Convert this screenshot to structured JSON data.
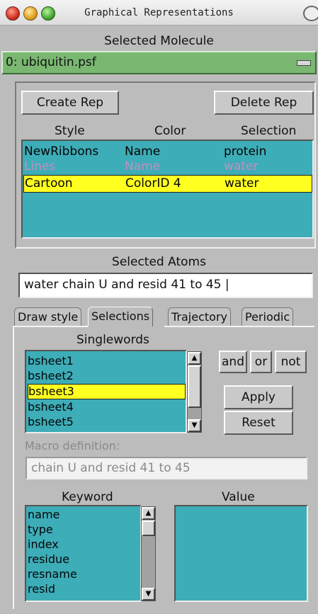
{
  "window": {
    "title": "Graphical Representations"
  },
  "molecule": {
    "section_label": "Selected Molecule",
    "value": "0: ubiquitin.psf"
  },
  "reps": {
    "create_label": "Create Rep",
    "delete_label": "Delete Rep",
    "headers": {
      "style": "Style",
      "color": "Color",
      "selection": "Selection"
    },
    "rows": [
      {
        "style": "NewRibbons",
        "color": "Name",
        "selection": "protein"
      },
      {
        "style": "Lines",
        "color": "Name",
        "selection": "water"
      },
      {
        "style": "Cartoon",
        "color": "ColorID 4",
        "selection": "water"
      }
    ]
  },
  "selected_atoms": {
    "label": "Selected Atoms",
    "value": "water chain U and resid 41 to 45 |"
  },
  "tabs": [
    {
      "label": "Draw style"
    },
    {
      "label": "Selections"
    },
    {
      "label": "Trajectory"
    },
    {
      "label": "Periodic"
    }
  ],
  "singlewords": {
    "label": "Singlewords",
    "items": [
      "bsheet1",
      "bsheet2",
      "bsheet3",
      "bsheet4",
      "bsheet5"
    ]
  },
  "ops": {
    "and": "and",
    "or": "or",
    "not": "not",
    "apply": "Apply",
    "reset": "Reset"
  },
  "macro": {
    "label": "Macro definition:",
    "value": "chain U and resid 41 to 45"
  },
  "keyword": {
    "label": "Keyword",
    "items": [
      "name",
      "type",
      "index",
      "residue",
      "resname",
      "resid"
    ]
  },
  "value": {
    "label": "Value"
  },
  "colors": {
    "list_bg": "#3dadb8",
    "highlight": "#ffff20",
    "molecule_bg": "#7ab872"
  }
}
